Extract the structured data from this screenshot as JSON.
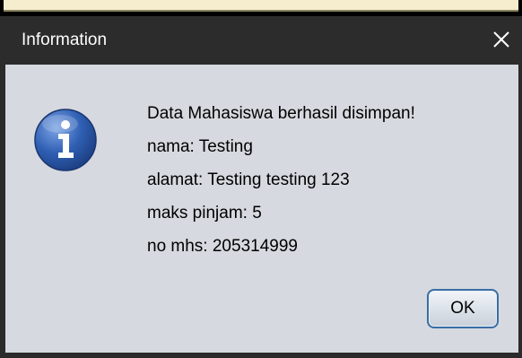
{
  "dialog": {
    "title": "Information",
    "icon": "info-icon",
    "messages": [
      "Data Mahasiswa berhasil disimpan!",
      "nama: Testing",
      "alamat: Testing testing 123",
      "maks pinjam: 5",
      "no mhs: 205314999"
    ],
    "ok_label": "OK"
  },
  "colors": {
    "titlebar": "#2c2c2c",
    "content_background": "#d6d9df",
    "ok_border": "#3a6ea5",
    "icon_blue": "#2f5fb3"
  }
}
